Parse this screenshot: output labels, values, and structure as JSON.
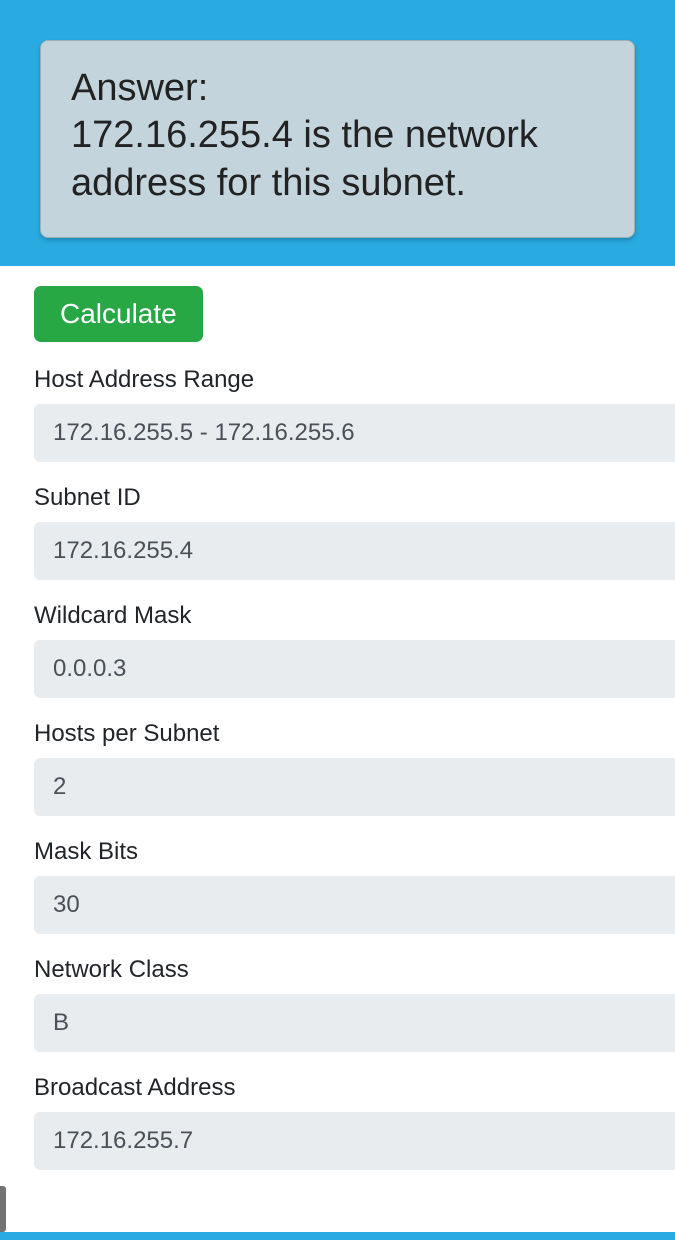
{
  "answer": {
    "title": "Answer:",
    "text": "172.16.255.4 is the network address for this subnet."
  },
  "calculate_button": "Calculate",
  "fields": {
    "host_range": {
      "label": "Host Address Range",
      "value": "172.16.255.5 - 172.16.255.6"
    },
    "subnet_id": {
      "label": "Subnet ID",
      "value": "172.16.255.4"
    },
    "wildcard_mask": {
      "label": "Wildcard Mask",
      "value": "0.0.0.3"
    },
    "hosts_per_subnet": {
      "label": "Hosts per Subnet",
      "value": "2"
    },
    "mask_bits": {
      "label": "Mask Bits",
      "value": "30"
    },
    "network_class": {
      "label": "Network Class",
      "value": "B"
    },
    "broadcast": {
      "label": "Broadcast Address",
      "value": "172.16.255.7"
    }
  }
}
